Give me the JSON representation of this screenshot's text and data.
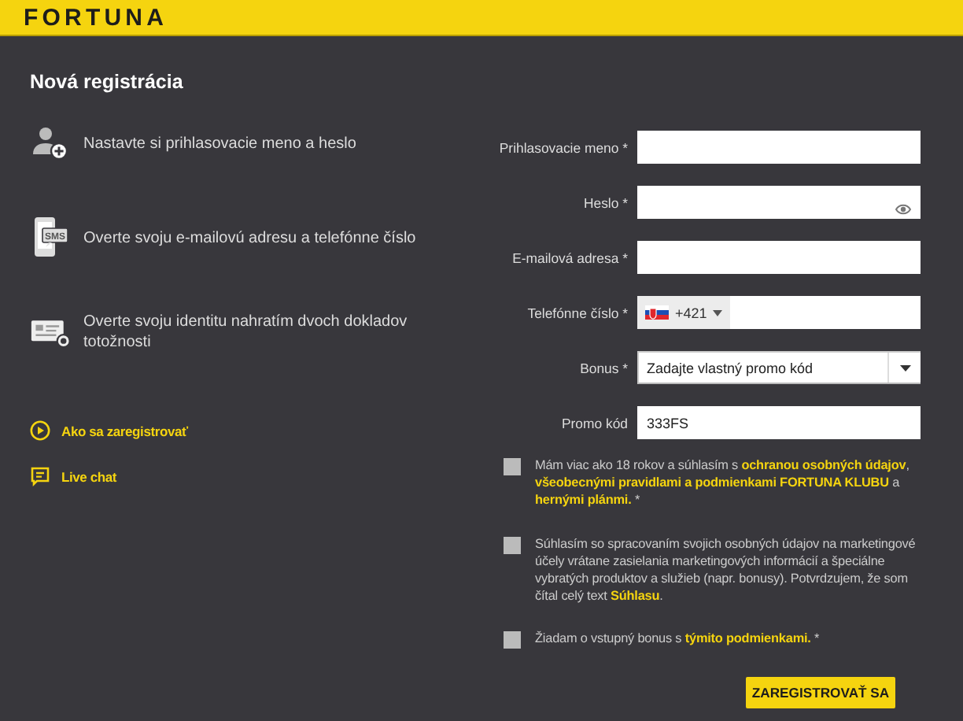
{
  "header": {
    "logo": "FORTUNA"
  },
  "title": "Nová registrácia",
  "steps": [
    {
      "kind": "account",
      "text": "Nastavte si prihlasovacie meno a heslo"
    },
    {
      "kind": "sms",
      "badge": "SMS",
      "text": "Overte svoju e-mailovú adresu a telefónne číslo"
    },
    {
      "kind": "id",
      "text": "Overte svoju identitu nahratím dvoch dokladov totožnosti"
    }
  ],
  "help_links": [
    {
      "kind": "video",
      "label": "Ako sa zaregistrovať"
    },
    {
      "kind": "chat",
      "label": "Live chat"
    }
  ],
  "fields": [
    {
      "kind": "text",
      "label": "Prihlasovacie meno *"
    },
    {
      "kind": "password",
      "label": "Heslo *"
    },
    {
      "kind": "text",
      "label": "E-mailová adresa *"
    },
    {
      "kind": "phone",
      "label": "Telefónne číslo *",
      "prefix": "+421"
    },
    {
      "kind": "select",
      "label": "Bonus *",
      "value": "Zadajte vlastný promo kód"
    },
    {
      "kind": "text",
      "label": "Promo kód",
      "value": "333FS"
    }
  ],
  "consents": [
    {
      "checked": false,
      "text": "Mám viac ako 18 rokov a súhlasím s **ochranou osobných údajov**, **všeobecnými pravidlami a podmienkami FORTUNA KLUBU** a **hernými plánmi.** *"
    },
    {
      "checked": false,
      "text": "Súhlasím so spracovaním svojich osobných údajov na marketingové účely vrátane zasielania marketingových informácií a špeciálne vybratých produktov a služieb (napr. bonusy). Potvrdzujem, že som čítal celý text **Súhlasu**."
    },
    {
      "checked": false,
      "text": "Žiadam o vstupný bonus s **týmito podmienkami.** *"
    }
  ],
  "submit": "ZAREGISTROVAŤ SA"
}
